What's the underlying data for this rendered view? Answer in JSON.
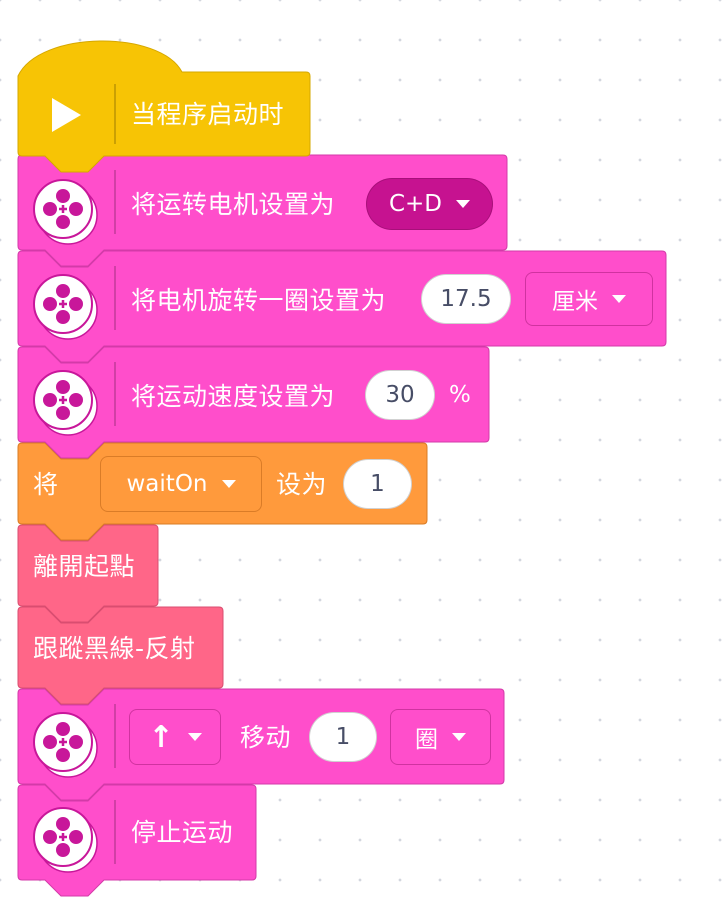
{
  "colors": {
    "events": "#f7c405",
    "motors": "#ff4ecb",
    "variables": "#ff9a3c",
    "myblocks": "#ff6688",
    "motor_dropdown": "#c61290"
  },
  "blocks": [
    {
      "id": "when-program-starts",
      "label": "当程序启动时",
      "icon": "play-icon"
    },
    {
      "id": "set-movement-motors",
      "label": "将运转电机设置为",
      "motors": "C+D",
      "icon": "motor-icon"
    },
    {
      "id": "set-motor-rotation",
      "label": "将电机旋转一圈设置为",
      "value": "17.5",
      "unit": "厘米",
      "icon": "motor-icon"
    },
    {
      "id": "set-movement-speed",
      "label": "将运动速度设置为",
      "value": "30",
      "unit": "%",
      "icon": "motor-icon"
    },
    {
      "id": "set-variable",
      "prefix": "将",
      "variable": "waitOn",
      "mid": "设为",
      "value": "1"
    },
    {
      "id": "leave-start",
      "label": "離開起點"
    },
    {
      "id": "follow-line",
      "label": "跟蹤黑線-反射"
    },
    {
      "id": "move",
      "direction": "↑",
      "label": "移动",
      "value": "1",
      "unit": "圈",
      "icon": "motor-icon"
    },
    {
      "id": "stop-moving",
      "label": "停止运动",
      "icon": "motor-icon"
    }
  ]
}
